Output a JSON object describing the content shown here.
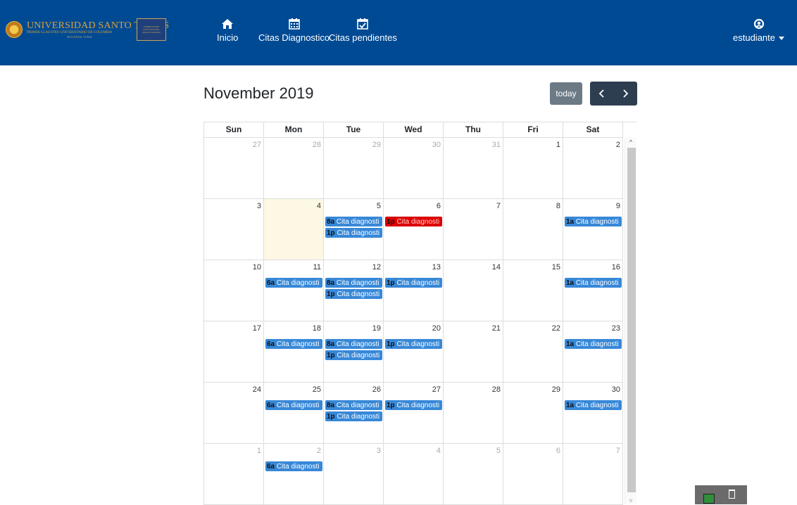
{
  "header": {
    "logo_text": "UNIVERSIDAD SANTO TOMÁS",
    "logo_subtext": "PRIMER CLAUSTRO UNIVERSITARIO DE COLOMBIA",
    "logo_subtext2": "SECCIONAL TUNJA",
    "accreditation_lines": [
      "ACREDITACIÓN",
      "INSTITUCIONAL",
      "DE ALTA CALIDAD"
    ],
    "nav": [
      {
        "label": "Inicio",
        "icon": "home-icon"
      },
      {
        "label": "Citas Diagnostico",
        "icon": "calendar-icon"
      },
      {
        "label": "Citas pendientes",
        "icon": "calendar-check-icon"
      }
    ],
    "user": {
      "label": "estudiante",
      "icon": "user-icon"
    }
  },
  "calendar": {
    "title": "November 2019",
    "today_label": "today",
    "prev_icon": "chevron-left-icon",
    "next_icon": "chevron-right-icon",
    "weekdays": [
      "Sun",
      "Mon",
      "Tue",
      "Wed",
      "Thu",
      "Fri",
      "Sat"
    ],
    "weeks": [
      [
        {
          "day": "27",
          "other": true,
          "events": []
        },
        {
          "day": "28",
          "other": true,
          "events": []
        },
        {
          "day": "29",
          "other": true,
          "events": []
        },
        {
          "day": "30",
          "other": true,
          "events": []
        },
        {
          "day": "31",
          "other": true,
          "events": []
        },
        {
          "day": "1",
          "events": []
        },
        {
          "day": "2",
          "events": []
        }
      ],
      [
        {
          "day": "3",
          "events": []
        },
        {
          "day": "4",
          "today": true,
          "events": []
        },
        {
          "day": "5",
          "events": [
            {
              "time": "8a",
              "title": "Cita diagnosti"
            },
            {
              "time": "1p",
              "title": "Cita diagnosti"
            }
          ]
        },
        {
          "day": "6",
          "events": [
            {
              "time": "1p",
              "title": "Cita diagnosti",
              "color": "red"
            }
          ]
        },
        {
          "day": "7",
          "events": []
        },
        {
          "day": "8",
          "events": []
        },
        {
          "day": "9",
          "events": [
            {
              "time": "1a",
              "title": "Cita diagnosti"
            }
          ]
        }
      ],
      [
        {
          "day": "10",
          "events": []
        },
        {
          "day": "11",
          "events": [
            {
              "time": "6a",
              "title": "Cita diagnosti"
            }
          ]
        },
        {
          "day": "12",
          "events": [
            {
              "time": "8a",
              "title": "Cita diagnosti"
            },
            {
              "time": "1p",
              "title": "Cita diagnosti"
            }
          ]
        },
        {
          "day": "13",
          "events": [
            {
              "time": "1p",
              "title": "Cita diagnosti"
            }
          ]
        },
        {
          "day": "14",
          "events": []
        },
        {
          "day": "15",
          "events": []
        },
        {
          "day": "16",
          "events": [
            {
              "time": "1a",
              "title": "Cita diagnosti"
            }
          ]
        }
      ],
      [
        {
          "day": "17",
          "events": []
        },
        {
          "day": "18",
          "events": [
            {
              "time": "6a",
              "title": "Cita diagnosti"
            }
          ]
        },
        {
          "day": "19",
          "events": [
            {
              "time": "8a",
              "title": "Cita diagnosti"
            },
            {
              "time": "1p",
              "title": "Cita diagnosti"
            }
          ]
        },
        {
          "day": "20",
          "events": [
            {
              "time": "1p",
              "title": "Cita diagnosti"
            }
          ]
        },
        {
          "day": "21",
          "events": []
        },
        {
          "day": "22",
          "events": []
        },
        {
          "day": "23",
          "events": [
            {
              "time": "1a",
              "title": "Cita diagnosti"
            }
          ]
        }
      ],
      [
        {
          "day": "24",
          "events": []
        },
        {
          "day": "25",
          "events": [
            {
              "time": "6a",
              "title": "Cita diagnosti"
            }
          ]
        },
        {
          "day": "26",
          "events": [
            {
              "time": "8a",
              "title": "Cita diagnosti"
            },
            {
              "time": "1p",
              "title": "Cita diagnosti"
            }
          ]
        },
        {
          "day": "27",
          "events": [
            {
              "time": "1p",
              "title": "Cita diagnosti"
            }
          ]
        },
        {
          "day": "28",
          "events": []
        },
        {
          "day": "29",
          "events": []
        },
        {
          "day": "30",
          "events": [
            {
              "time": "1a",
              "title": "Cita diagnosti"
            }
          ]
        }
      ],
      [
        {
          "day": "1",
          "other": true,
          "events": []
        },
        {
          "day": "2",
          "other": true,
          "events": [
            {
              "time": "6a",
              "title": "Cita diagnosti"
            }
          ]
        },
        {
          "day": "3",
          "other": true,
          "events": []
        },
        {
          "day": "4",
          "other": true,
          "events": []
        },
        {
          "day": "5",
          "other": true,
          "events": []
        },
        {
          "day": "6",
          "other": true,
          "events": []
        },
        {
          "day": "7",
          "other": true,
          "events": []
        }
      ]
    ]
  },
  "colors": {
    "navbar": "#004a94",
    "event_blue": "#3788d8",
    "event_red": "#e00000",
    "today_bg": "#fcf8e3",
    "today_btn": "#6c7a86",
    "nav_btn": "#2c3e50"
  }
}
